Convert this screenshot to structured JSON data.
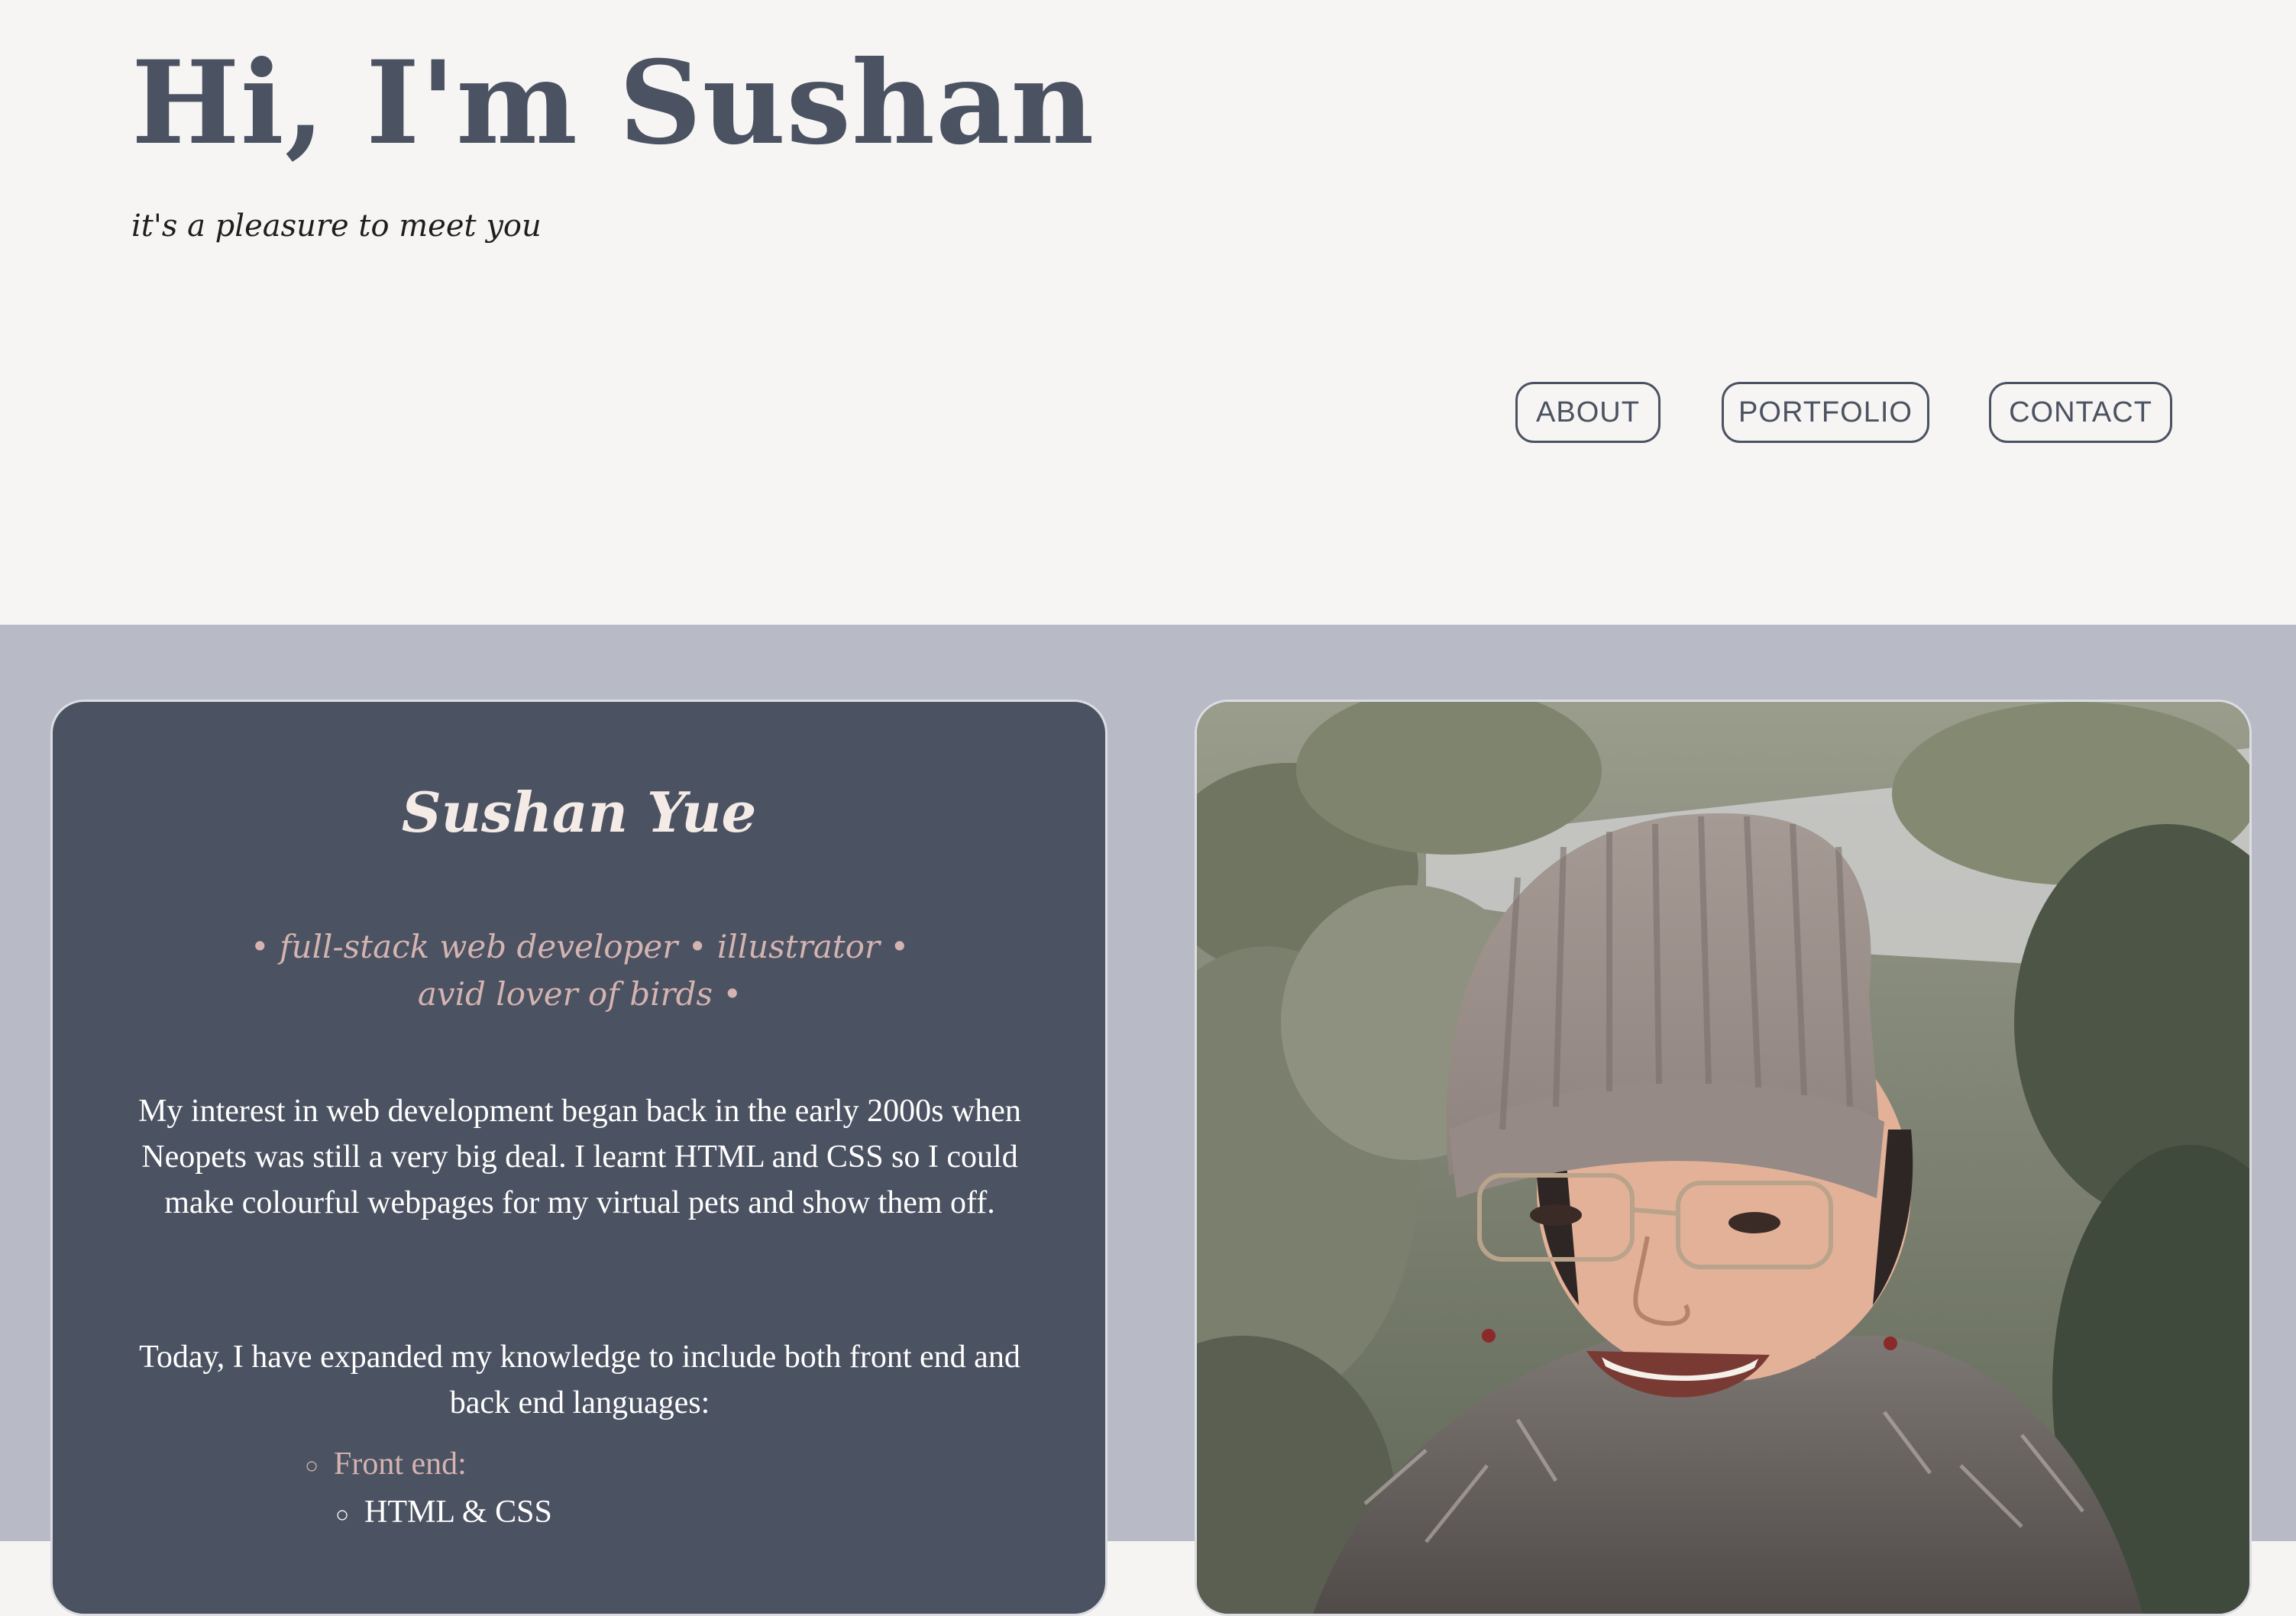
{
  "header": {
    "title": "Hi, I'm Sushan",
    "tagline": "it's a pleasure to meet you"
  },
  "nav": {
    "items": [
      {
        "label": "ABOUT"
      },
      {
        "label": "PORTFOLIO"
      },
      {
        "label": "CONTACT"
      }
    ]
  },
  "about": {
    "name": "Sushan Yue",
    "roles": "• full-stack web developer • illustrator • avid lover of birds •",
    "bio_1": "My interest in web development began back in the early 2000s when Neopets was still a very big deal. I learnt HTML and CSS so I could make colourful webpages for my virtual pets and show them off.",
    "bio_2": "Today, I have expanded my knowledge to include both front end and back end languages:",
    "skills": {
      "heading": "Front end:",
      "items": [
        "HTML & CSS"
      ]
    }
  },
  "colors": {
    "primary": "#4b5261",
    "page_bg": "#f6f5f3",
    "section_bg": "#b8bac6",
    "accent": "#d4b3b0"
  },
  "photo": {
    "icon": "portrait-photo"
  }
}
